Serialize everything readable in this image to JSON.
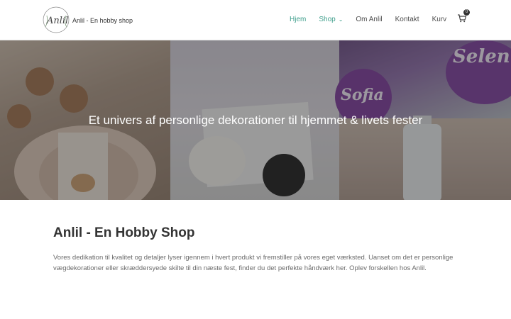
{
  "site": {
    "logo_script": "Anlil",
    "logo_text": "Anlil - En hobby shop"
  },
  "nav": {
    "items": [
      {
        "label": "Hjem",
        "active": true
      },
      {
        "label": "Shop",
        "has_dropdown": true
      },
      {
        "label": "Om Anlil"
      },
      {
        "label": "Kontakt"
      },
      {
        "label": "Kurv"
      }
    ],
    "cart_count": "0",
    "accent_color": "#3f9f8c"
  },
  "hero": {
    "title": "Et univers af personlige dekorationer til hjemmet & livets fester",
    "ornament_text_1": "Sofia",
    "ornament_text_2": "Selen"
  },
  "main": {
    "title": "Anlil - En Hobby Shop",
    "description": "Vores dedikation til kvalitet og detaljer lyser igennem i hvert produkt vi fremstiller på vores eget værksted. Uanset om det er personlige vægdekorationer eller skræddersyede skilte til din næste fest, finder du det perfekte håndværk her. Oplev forskellen hos Anlil."
  }
}
